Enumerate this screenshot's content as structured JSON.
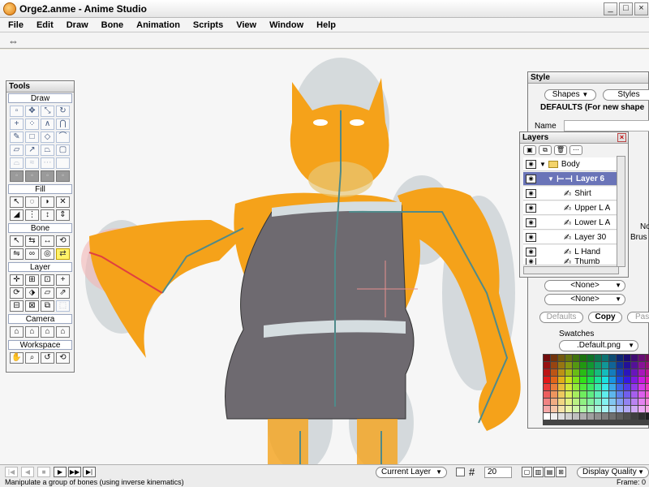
{
  "window": {
    "title": "Orge2.anme - Anime Studio",
    "minimize": "_",
    "maximize": "□",
    "close": "×"
  },
  "menu": [
    "File",
    "Edit",
    "Draw",
    "Bone",
    "Animation",
    "Scripts",
    "View",
    "Window",
    "Help"
  ],
  "tools": {
    "title": "Tools",
    "sections": {
      "draw": "Draw",
      "fill": "Fill",
      "bone": "Bone",
      "layer": "Layer",
      "camera": "Camera",
      "workspace": "Workspace"
    }
  },
  "style_panel": {
    "title": "Style",
    "shapes_btn": "Shapes",
    "styles_btn": "Styles",
    "defaults_heading": "DEFAULTS (For new shape",
    "name_label": "Name",
    "none_1": "<None>",
    "none_2": "<None>",
    "defaults_btn": "Defaults",
    "copy_btn": "Copy",
    "paste_btn": "Past",
    "swatches_label": "Swatches",
    "swatch_file": ".Default.png",
    "frag_no": "No",
    "frag_brus": "Brus"
  },
  "layers_panel": {
    "title": "Layers",
    "close": "×",
    "rows": [
      {
        "name": "Body"
      },
      {
        "name": "Layer 6"
      },
      {
        "name": "Shirt"
      },
      {
        "name": "Upper L A"
      },
      {
        "name": "Lower L A"
      },
      {
        "name": "Layer 30"
      },
      {
        "name": "L Hand"
      },
      {
        "name": "Thumb"
      }
    ]
  },
  "timeline": {
    "layer_mode": "Current Layer",
    "frame_count": "20",
    "display_quality": "Display Quality"
  },
  "status": {
    "message": "Manipulate a group of bones (using inverse kinematics)",
    "frame": "Frame: 0"
  },
  "colors": {
    "ogre_orange": "#f5a21a",
    "shirt_gray": "#6e6a70",
    "bone_teal": "#4f8a8a",
    "selected_layer": "#6a74b8"
  }
}
